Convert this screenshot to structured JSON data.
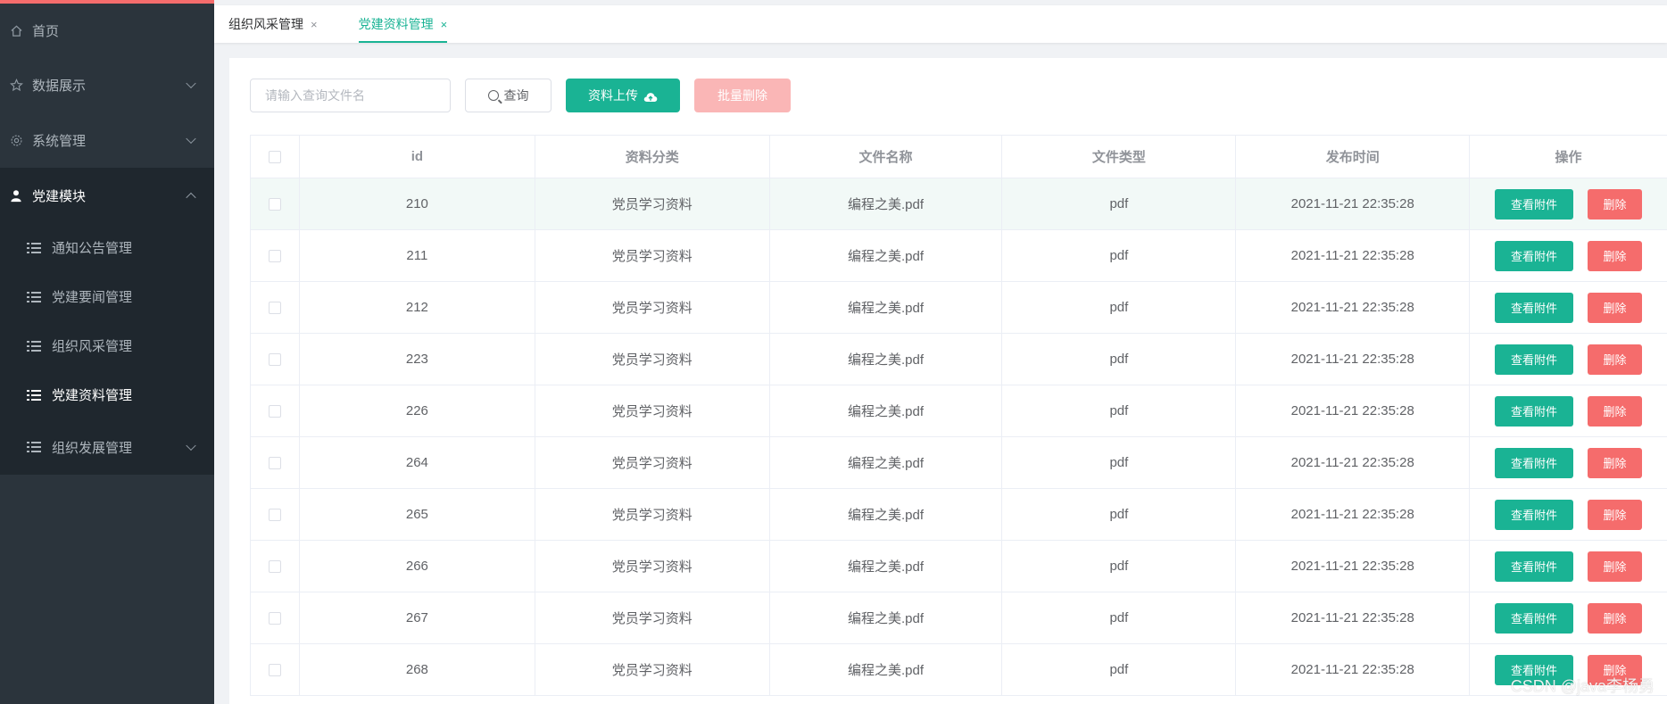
{
  "sidebar": {
    "items": [
      {
        "label": "首页",
        "icon": "home-icon"
      },
      {
        "label": "数据展示",
        "icon": "star-icon"
      },
      {
        "label": "系统管理",
        "icon": "gear-icon"
      },
      {
        "label": "党建模块",
        "icon": "user-icon"
      }
    ],
    "sub_items": [
      {
        "label": "通知公告管理"
      },
      {
        "label": "党建要闻管理"
      },
      {
        "label": "组织风采管理"
      },
      {
        "label": "党建资料管理"
      },
      {
        "label": "组织发展管理"
      }
    ]
  },
  "tabs": [
    {
      "label": "组织风采管理",
      "close": "×"
    },
    {
      "label": "党建资料管理",
      "close": "×"
    }
  ],
  "toolbar": {
    "search_placeholder": "请输入查询文件名",
    "query_label": "查询",
    "upload_label": "资料上传",
    "batch_delete_label": "批量删除"
  },
  "table": {
    "headers": [
      "id",
      "资料分类",
      "文件名称",
      "文件类型",
      "发布时间",
      "操作"
    ],
    "rows": [
      {
        "id": "210",
        "category": "党员学习资料",
        "name": "编程之美.pdf",
        "type": "pdf",
        "time": "2021-11-21 22:35:28"
      },
      {
        "id": "211",
        "category": "党员学习资料",
        "name": "编程之美.pdf",
        "type": "pdf",
        "time": "2021-11-21 22:35:28"
      },
      {
        "id": "212",
        "category": "党员学习资料",
        "name": "编程之美.pdf",
        "type": "pdf",
        "time": "2021-11-21 22:35:28"
      },
      {
        "id": "223",
        "category": "党员学习资料",
        "name": "编程之美.pdf",
        "type": "pdf",
        "time": "2021-11-21 22:35:28"
      },
      {
        "id": "226",
        "category": "党员学习资料",
        "name": "编程之美.pdf",
        "type": "pdf",
        "time": "2021-11-21 22:35:28"
      },
      {
        "id": "264",
        "category": "党员学习资料",
        "name": "编程之美.pdf",
        "type": "pdf",
        "time": "2021-11-21 22:35:28"
      },
      {
        "id": "265",
        "category": "党员学习资料",
        "name": "编程之美.pdf",
        "type": "pdf",
        "time": "2021-11-21 22:35:28"
      },
      {
        "id": "266",
        "category": "党员学习资料",
        "name": "编程之美.pdf",
        "type": "pdf",
        "time": "2021-11-21 22:35:28"
      },
      {
        "id": "267",
        "category": "党员学习资料",
        "name": "编程之美.pdf",
        "type": "pdf",
        "time": "2021-11-21 22:35:28"
      },
      {
        "id": "268",
        "category": "党员学习资料",
        "name": "编程之美.pdf",
        "type": "pdf",
        "time": "2021-11-21 22:35:28"
      }
    ],
    "view_label": "查看附件",
    "delete_label": "删除"
  },
  "watermark": "CSDN @java李杨勇",
  "colors": {
    "accent": "#1ab394",
    "danger": "#f56c6c",
    "danger_light": "#fab6b6",
    "sidebar": "#2b343c"
  }
}
